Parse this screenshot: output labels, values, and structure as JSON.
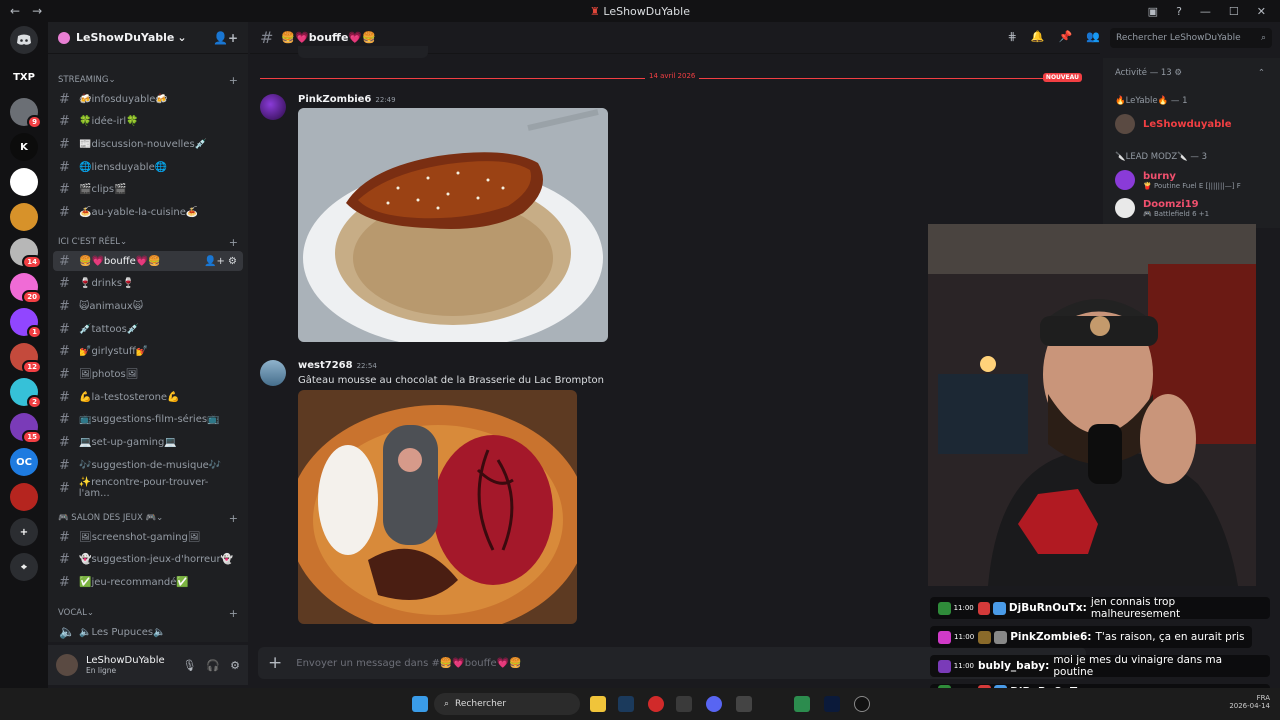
{
  "window": {
    "title": "LeShowDuYable",
    "back": "←",
    "forward": "→"
  },
  "servers": [
    {
      "label": "TXP",
      "color": "#121214",
      "badge": ""
    },
    {
      "label": "",
      "color": "#6b6f75",
      "badge": "9"
    },
    {
      "label": "K",
      "color": "#0c0c0c",
      "badge": ""
    },
    {
      "label": "",
      "color": "#ffffff",
      "badge": ""
    },
    {
      "label": "",
      "color": "#d7922a",
      "badge": ""
    },
    {
      "label": "",
      "color": "#b7b7b7",
      "badge": "14"
    },
    {
      "label": "",
      "color": "#f06bd6",
      "badge": "20"
    },
    {
      "label": "",
      "color": "#9146ff",
      "badge": "1"
    },
    {
      "label": "",
      "color": "#c44a3c",
      "badge": "12"
    },
    {
      "label": "",
      "color": "#36c1d8",
      "badge": "2"
    },
    {
      "label": "",
      "color": "#7a3bb8",
      "badge": "15"
    },
    {
      "label": "OC",
      "color": "#1e7be0",
      "badge": ""
    },
    {
      "label": "",
      "color": "#b5251f",
      "badge": ""
    },
    {
      "label": "+",
      "color": "#2b2d31",
      "badge": ""
    },
    {
      "label": "⌖",
      "color": "#2b2d31",
      "badge": ""
    }
  ],
  "guild": {
    "name": "LeShowDuYable",
    "chevron": "⌄"
  },
  "categories": {
    "streaming": "STREAMING",
    "reel": "ICI C'EST RÉEL",
    "jeux": "🎮 SALON DES JEUX 🎮",
    "vocal": "VOCAL"
  },
  "channels_streaming": [
    "🍻infosduyable🍻",
    "🍀idée-irl🍀",
    "📰discussion-nouvelles💉",
    "🌐liensduyable🌐",
    "🎬clips🎬",
    "🍝au-yable-la-cuisine🍝"
  ],
  "channels_reel": [
    "🍔💗bouffe💗🍔",
    "🍷drinks🍷",
    "🙀animaux🙀",
    "💉tattoos💉",
    "💅girlystuff💅",
    "🖼photos🖼",
    "💪la-testosterone💪",
    "📺suggestions-film-séries📺",
    "💻set-up-gaming💻",
    "🎶suggestion-de-musique🎶",
    "✨rencontre-pour-trouver-l'am..."
  ],
  "channels_jeux": [
    "🖼screenshot-gaming🖼",
    "👻suggestion-jeux-d'horreur👻",
    "✅jeu-recommandé✅"
  ],
  "channels_vocal": [
    "🔈Les Pupuces🔈"
  ],
  "user": {
    "name": "LeShowDuYable",
    "status": "En ligne"
  },
  "header": {
    "channel": "🍔💗bouffe💗🍔",
    "search_placeholder": "Rechercher LeShowDuYable"
  },
  "divider": {
    "date": "14 avril 2026",
    "new_label": "NOUVEAU"
  },
  "messages": [
    {
      "author": "PinkZombie6",
      "time": "22:49",
      "text": ""
    },
    {
      "author": "west7268",
      "time": "22:54",
      "text": "Gâteau mousse au chocolat de la Brasserie du Lac Brompton"
    }
  ],
  "composer": {
    "placeholder": "Envoyer un message dans #🍔💗bouffe💗🍔"
  },
  "members": {
    "activity": "Activité — 13 ⚙",
    "role1": "🔥LeYable🔥 — 1",
    "member1": "LeShowduyable",
    "role2": "🔪LEAD MODZ🔪 — 3",
    "member2": "burny",
    "member2_sub": "🍟 Poutine Fuel E [|||||||—] F",
    "member3": "Doomzi19",
    "member3_sub": "🎮 Battlefield 6 +1"
  },
  "overlay_chat": [
    {
      "time": "11:00",
      "user": "DjBuRnOuTx:",
      "text": "jen connais trop malheuresement",
      "ucolor": "#ffffff"
    },
    {
      "time": "11:00",
      "user": "PinkZombie6:",
      "text": "T'as raison, ça en aurait pris",
      "ucolor": "#ffffff"
    },
    {
      "time": "11:00",
      "user": "bubly_baby:",
      "text": "moi je mes du vinaigre dans ma poutine",
      "ucolor": "#ffffff"
    },
    {
      "time": "11:00",
      "user": "DjBuRnOuTx:",
      "text": "meme un gars quyen met dans des nouilles chinoises",
      "ucolor": "#ffffff"
    }
  ],
  "taskbar": {
    "search": "Rechercher",
    "lang": "FRA",
    "date": "2026-04-14"
  }
}
